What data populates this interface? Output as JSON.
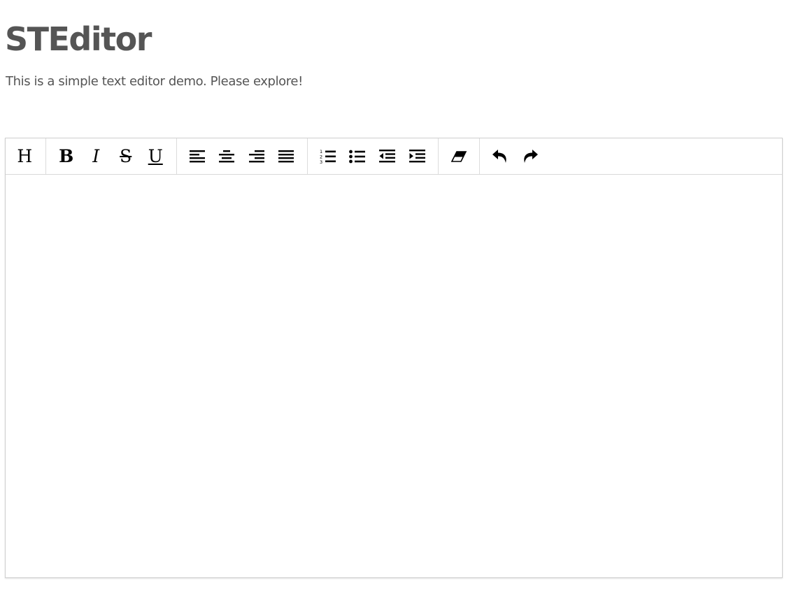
{
  "page": {
    "title": "STEditor",
    "subtitle": "This is a simple text editor demo. Please explore!"
  },
  "toolbar": {
    "groups": [
      [
        {
          "icon": "heading-icon",
          "glyph": "H"
        }
      ],
      [
        {
          "icon": "bold-icon",
          "glyph": "B"
        },
        {
          "icon": "italic-icon",
          "glyph": "I"
        },
        {
          "icon": "strikethrough-icon",
          "glyph": "S"
        },
        {
          "icon": "underline-icon",
          "glyph": "U"
        }
      ],
      [
        {
          "icon": "align-left-icon"
        },
        {
          "icon": "align-center-icon"
        },
        {
          "icon": "align-right-icon"
        },
        {
          "icon": "align-justify-icon"
        }
      ],
      [
        {
          "icon": "ordered-list-icon"
        },
        {
          "icon": "unordered-list-icon"
        },
        {
          "icon": "outdent-icon"
        },
        {
          "icon": "indent-icon"
        }
      ],
      [
        {
          "icon": "eraser-icon"
        }
      ],
      [
        {
          "icon": "undo-icon"
        },
        {
          "icon": "redo-icon"
        }
      ]
    ]
  },
  "editor": {
    "content": ""
  },
  "colors": {
    "text": "#555555",
    "border": "#cfcfcf",
    "icon": "#000000"
  }
}
